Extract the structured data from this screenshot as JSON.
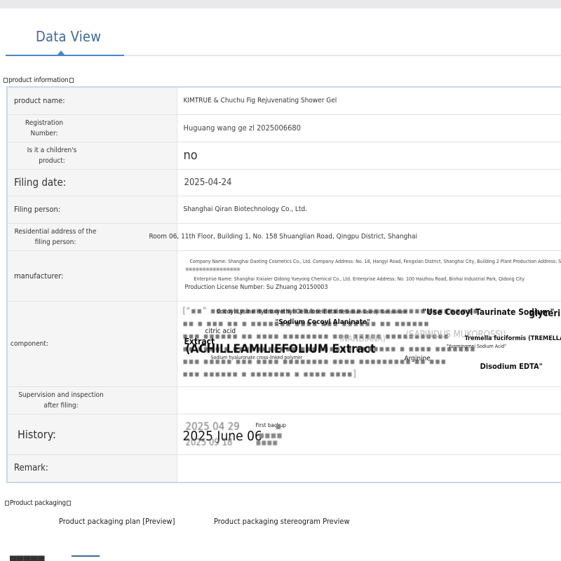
{
  "tab": {
    "title": "Data View"
  },
  "sections": {
    "product_info": "product information",
    "packaging": "Product packaging"
  },
  "labels": {
    "product_name": "product name:",
    "registration_number": "Registration Number:",
    "childrens_product": "Is it a children's product:",
    "filing_date": "Filing date:",
    "filing_person": "Filing person:",
    "residential_address": "Residential address of the filing person:",
    "manufacturer": "manufacturer:",
    "component": "component:",
    "supervision": "Supervision and inspection after filing:",
    "history": "History:",
    "remark": "Remark:"
  },
  "values": {
    "product_name": "KIMTRUE & Chuchu Fig Rejuvenating Shower Gel",
    "registration_number": "Huguang wang ge zl 2025006680",
    "childrens_product": "no",
    "filing_date": "2025-04-24",
    "filing_person": "Shanghai Qiran Biotechnology Co., Ltd.",
    "residential_address": "Room 06, 11th Floor, Building 1, No. 158 Shuanglian Road, Qingpu District, Shanghai",
    "manufacturer_line1": "Company Name: Shanghai Daoting Cosmetics Co., Ltd. Company Address: No. 18, Hangyi Road, Fengxian District, Shanghai City, Building 2 Plant Production Address: Sh",
    "manufacturer_line2": "Enterprise Name: Shanghai Xixiaier Qidong Yueyong Chemical Co., Ltd. Enterprise Address: No. 100 Haizhou Road, Binhai Industrial Park, Qidong City",
    "manufacturer_line3": "Production License Number: Su Zhuang 20150003",
    "supervision": "",
    "remark": ""
  },
  "component_terms": {
    "t1": "Cocoyl Lysine Hydroxyethyl Cellulose Betaine",
    "t2": "Sodium Lauroyl Sarcosinate",
    "t3": "\"Use Cocoyl Taurinate Sodium\"",
    "t4": "glycerin",
    "t5": "\"Sodium Cocoyl Alaninate\"",
    "t6": "citric acid",
    "t7": "Extract",
    "t8": "(SAPINDUS MUKOROSSI)",
    "t9": "Tremella fuciformis (TREMELLAFUC",
    "t10": "(ACHILLEAMILIEFOLIUM Extract",
    "t11": "\"Yunmingmei Sodium Acid\"",
    "t12": "Sodium hyaluronate cross-linked polymer",
    "t13": "Arginine",
    "t14": "Disodium EDTA\"",
    "t15": "INANDIANA)"
  },
  "history": {
    "entry1_date": "2025 04 29 ",
    "entry1_note": "First backup",
    "entry2_date": "2025 June 06",
    "entry3_date": "2025 09 18 "
  },
  "packaging": {
    "plan": "Product packaging plan [Preview]",
    "stereogram": "Product packaging stereogram Preview "
  }
}
